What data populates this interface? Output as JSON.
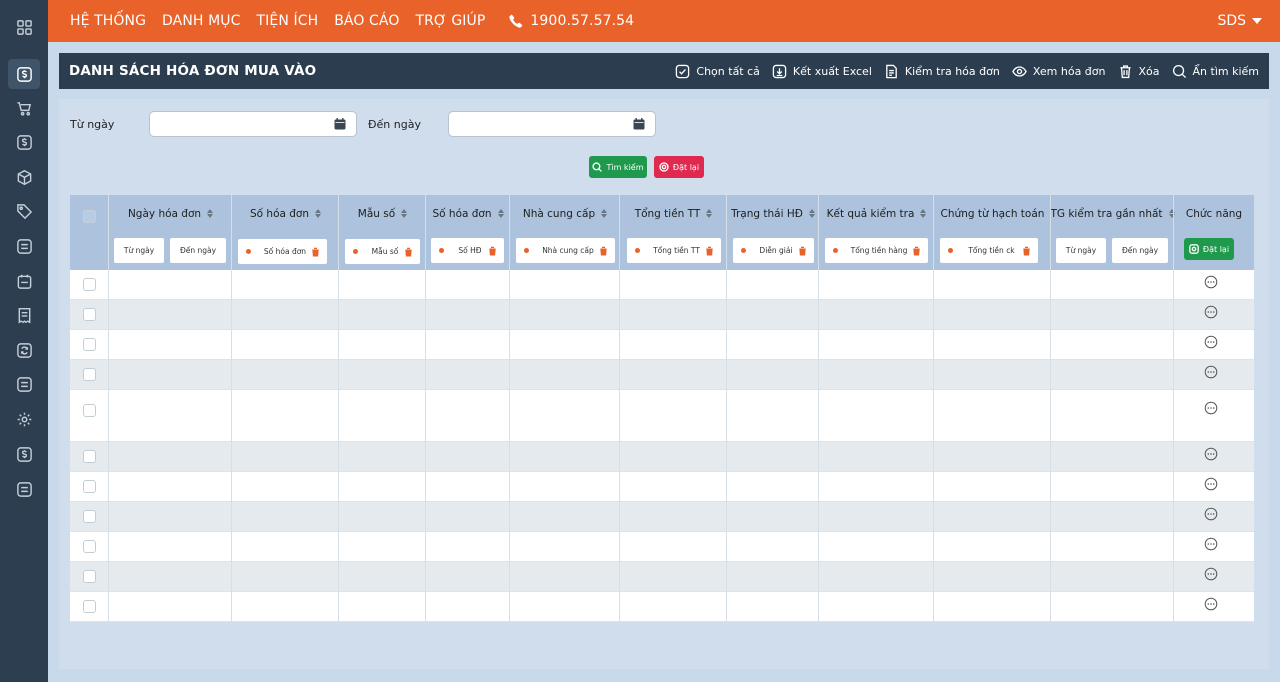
{
  "topbar": {
    "menu": [
      "HỆ THỐNG",
      "DANH MỤC",
      "TIỆN ÍCH",
      "BÁO CÁO",
      "TRỢ GIÚP"
    ],
    "hotline": "1900.57.57.54",
    "user": "SDS"
  },
  "panel": {
    "title": "DANH SÁCH HÓA ĐƠN MUA VÀO",
    "toolbar": {
      "select_all": "Chọn tất cả",
      "export_excel": "Kết xuất Excel",
      "check_invoice": "Kiểm tra hóa đơn",
      "view_invoice": "Xem hóa đơn",
      "delete": "Xóa",
      "hide_search": "Ẩn tìm kiếm"
    }
  },
  "search": {
    "from_label": "Từ ngày",
    "to_label": "Đến ngày",
    "from_value": "",
    "to_value": "",
    "search_button": "Tìm kiếm",
    "reset_button": "Đặt lại"
  },
  "table": {
    "columns": [
      "Ngày hóa đơn",
      "Số hóa đơn",
      "Mẫu số",
      "Số hóa đơn",
      "Nhà cung cấp",
      "Tổng tiền TT",
      "Trạng thái HĐ",
      "Kết quả kiểm tra",
      "Chứng từ hạch toán",
      "TG kiểm tra gần nhất",
      "Chức năng"
    ],
    "filters": {
      "date_from": "Từ ngày",
      "date_to": "Đến ngày",
      "invoice_no": "Số hóa đơn",
      "template": "Mẫu số",
      "invoice_no_short": "Số HĐ",
      "supplier": "Nhà cung cấp",
      "total": "Tổng tiền TT",
      "status": "Diễn giải",
      "check_result": "Tổng tiền hàng",
      "voucher": "Tổng tiền ck",
      "last_from": "Từ ngày",
      "last_to": "Đến ngày",
      "reset": "Đặt lại"
    },
    "row_count": 11
  },
  "colors": {
    "topbar": "#e8622a",
    "sidebar": "#2c3e50",
    "panel_header": "#2b3d4e",
    "search_button": "#1f9a4c",
    "reset_button": "#e0294f"
  },
  "icons": {
    "sidebar": [
      "grid-icon",
      "dollar-icon",
      "cart-icon",
      "dollar-icon",
      "box-icon",
      "tag-icon",
      "list-icon",
      "calendar-icon",
      "receipt-icon",
      "sync-icon",
      "list-icon",
      "gear-icon",
      "dollar-icon",
      "list-icon"
    ]
  }
}
